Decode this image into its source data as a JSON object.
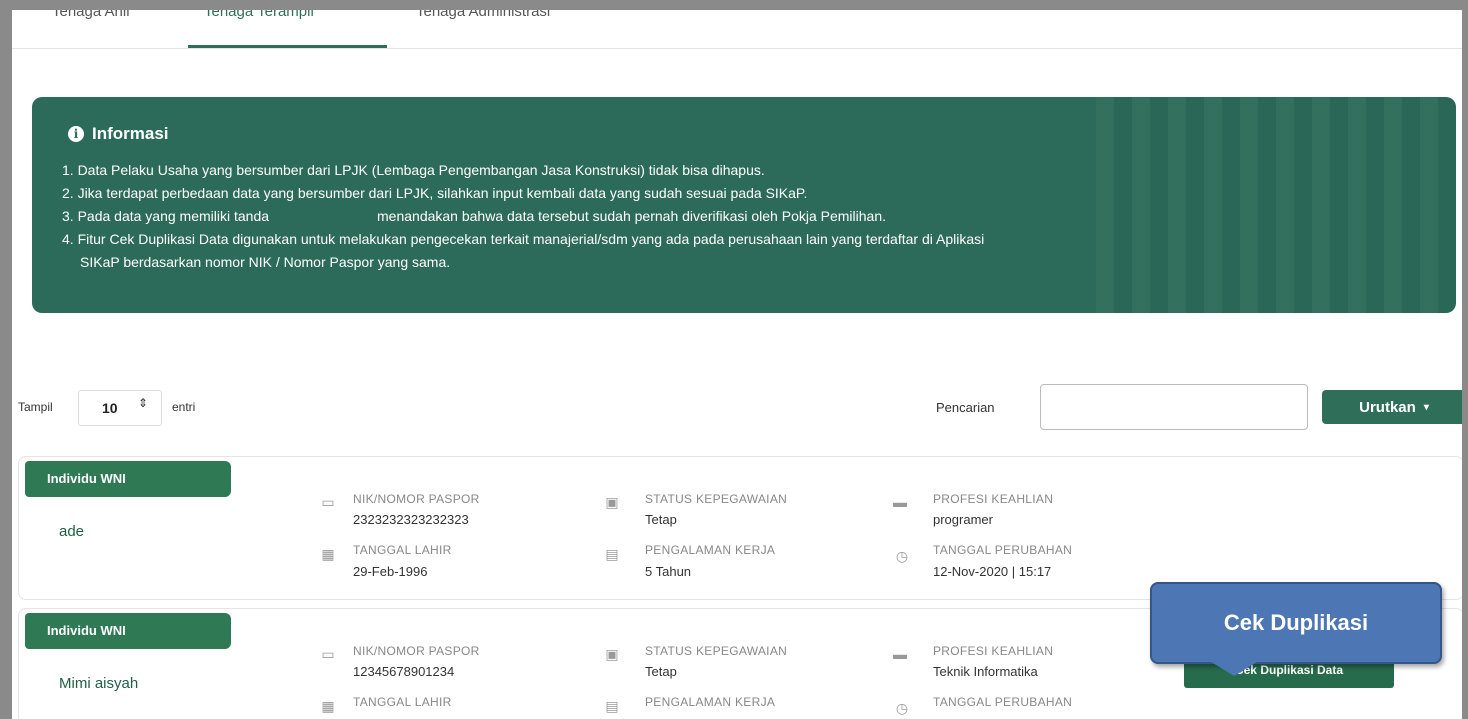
{
  "tabs": [
    {
      "label": "Tenaga Ahli",
      "active": false
    },
    {
      "label": "Tenaga Terampil",
      "active": true
    },
    {
      "label": "Tenaga Administrasi",
      "active": false
    }
  ],
  "info": {
    "title": "Informasi",
    "items": [
      "1. Data Pelaku Usaha yang bersumber dari LPJK (Lembaga Pengembangan Jasa Konstruksi) tidak bisa dihapus.",
      "2. Jika terdapat perbedaan data yang bersumber dari LPJK, silahkan input kembali data yang sudah sesuai pada SIKaP.",
      "3. Pada data yang memiliki tanda",
      "menandakan bahwa data tersebut sudah pernah diverifikasi oleh Pokja Pemilihan.",
      "4. Fitur Cek Duplikasi Data digunakan untuk melakukan pengecekan terkait manajerial/sdm yang ada pada perusahaan lain yang terdaftar di Aplikasi",
      "SIKaP berdasarkan nomor NIK / Nomor Paspor yang sama."
    ]
  },
  "controls": {
    "show_label": "Tampil",
    "show_value": "10",
    "entries_label": "entri",
    "search_label": "Pencarian",
    "search_value": "",
    "sort_label": "Urutkan"
  },
  "labels": {
    "nik": "NIK/NOMOR PASPOR",
    "status": "STATUS KEPEGAWAIAN",
    "profesi": "PROFESI KEAHLIAN",
    "tgl_lahir": "TANGGAL LAHIR",
    "pengalaman": "PENGALAMAN KERJA",
    "tgl_perubahan": "TANGGAL PERUBAHAN"
  },
  "records": [
    {
      "type": "Individu WNI",
      "name": "ade",
      "nik": "2323232323232323",
      "status": "Tetap",
      "profesi": "programer",
      "tgl_lahir": "29-Feb-1996",
      "pengalaman": "5 Tahun",
      "tgl_perubahan": "12-Nov-2020 | 15:17"
    },
    {
      "type": "Individu WNI",
      "name": "Mimi aisyah",
      "nik": "12345678901234",
      "status": "Tetap",
      "profesi": "Teknik Informatika"
    }
  ],
  "callout": "Cek Duplikasi",
  "dup_button": "Cek Duplikasi Data",
  "colors": {
    "primary": "#2f6f5a",
    "info_bg": "#2c6b59",
    "callout": "#4d76b4"
  }
}
